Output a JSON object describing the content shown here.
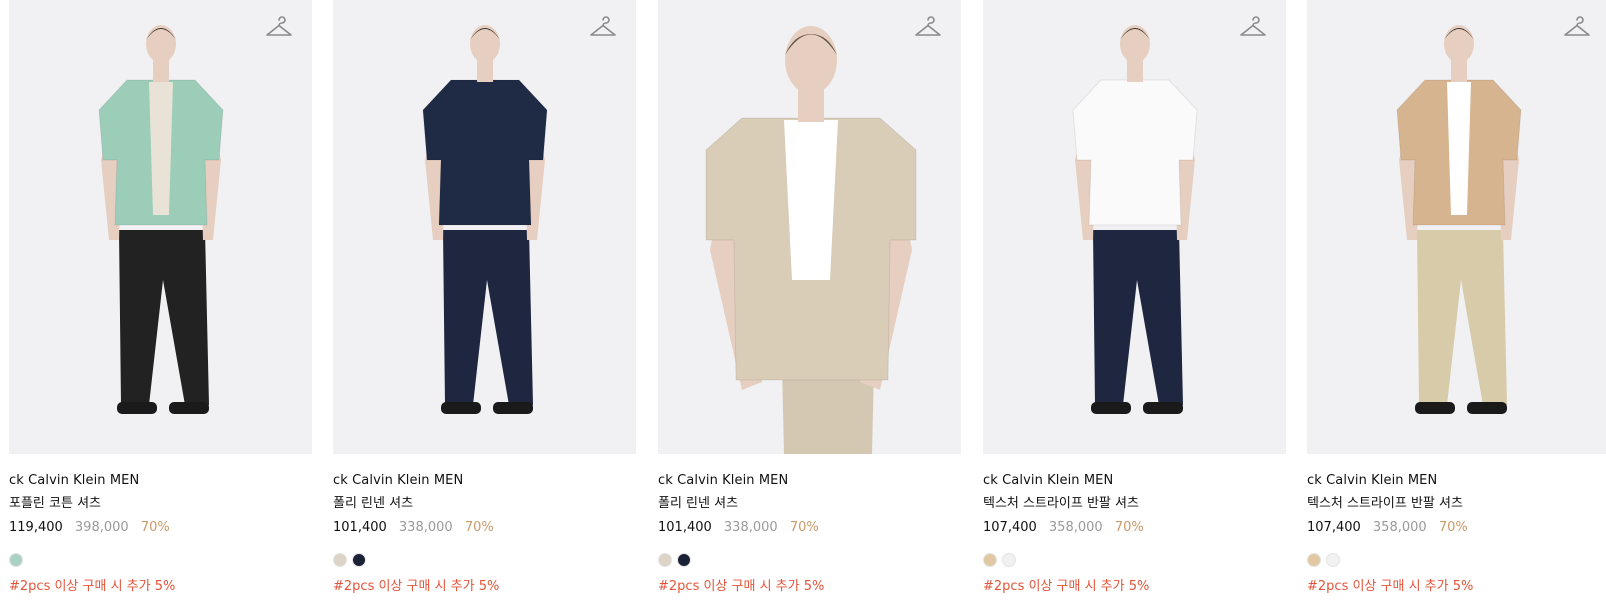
{
  "products": [
    {
      "brand": "ck Calvin Klein MEN",
      "name": "포플린 코튼 셔츠",
      "price": "119,400",
      "original_price": "398,000",
      "discount": "70%",
      "promo": "#2pcs 이상 구매 시 추가 5%",
      "image": {
        "bg": "#f1f1f3",
        "shirt": "#9ccdb9",
        "pants": "#222222",
        "inner": "#e9e2d6"
      },
      "swatches": [
        "#a8d1c4"
      ]
    },
    {
      "brand": "ck Calvin Klein MEN",
      "name": "폴리 린넨 셔츠",
      "price": "101,400",
      "original_price": "338,000",
      "discount": "70%",
      "promo": "#2pcs 이상 구매 시 추가 5%",
      "image": {
        "bg": "#f1f1f3",
        "shirt": "#1f2a44",
        "pants": "#1e2640",
        "inner": "#1f2a44"
      },
      "swatches": [
        "#ddd3c7",
        "#1b2238"
      ]
    },
    {
      "brand": "ck Calvin Klein MEN",
      "name": "폴리 린넨 셔츠",
      "price": "101,400",
      "original_price": "338,000",
      "discount": "70%",
      "promo": "#2pcs 이상 구매 시 추가 5%",
      "image": {
        "bg": "#f1f1f3",
        "shirt": "#d9cdb8",
        "pants": "#d5c8b3",
        "inner": "#ffffff"
      },
      "swatches": [
        "#ddd3c7",
        "#1b2238"
      ]
    },
    {
      "brand": "ck Calvin Klein MEN",
      "name": "텍스처 스트라이프 반팔 셔츠",
      "price": "107,400",
      "original_price": "358,000",
      "discount": "70%",
      "promo": "#2pcs 이상 구매 시 추가 5%",
      "image": {
        "bg": "#f1f1f3",
        "shirt": "#fafafa",
        "pants": "#1e2640",
        "inner": "#fafafa"
      },
      "swatches": [
        "#e2c9a4",
        "#f1f1f1"
      ]
    },
    {
      "brand": "ck Calvin Klein MEN",
      "name": "텍스처 스트라이프 반팔 셔츠",
      "price": "107,400",
      "original_price": "358,000",
      "discount": "70%",
      "promo": "#2pcs 이상 구매 시 추가 5%",
      "image": {
        "bg": "#f1f1f3",
        "shirt": "#d6b48f",
        "pants": "#d8cba9",
        "inner": "#ffffff"
      },
      "swatches": [
        "#e2c9a4",
        "#f1f1f1"
      ]
    }
  ],
  "icons": {
    "wishlist": "hanger-icon"
  }
}
